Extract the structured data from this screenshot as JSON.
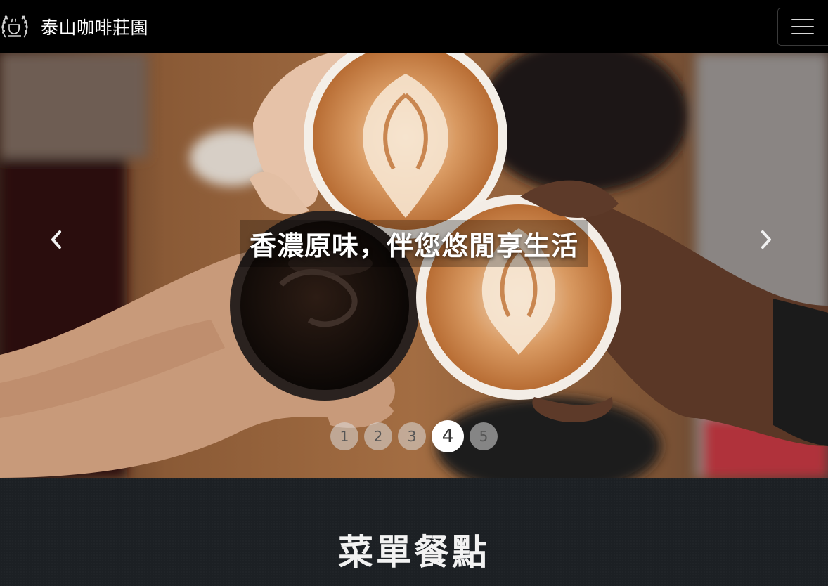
{
  "navbar": {
    "brand_name": "泰山咖啡莊園",
    "logo_icon": "laurel-coffee-crest-icon",
    "menu_icon": "hamburger-menu-icon"
  },
  "carousel": {
    "caption": "香濃原味，伴您悠閒享生活",
    "prev_icon": "chevron-left-icon",
    "next_icon": "chevron-right-icon",
    "indicators": [
      "1",
      "2",
      "3",
      "4",
      "5"
    ],
    "active_index": 4
  },
  "menu_section": {
    "title": "菜單餐點"
  },
  "colors": {
    "navbar_bg": "#000000",
    "section_bg": "#1c2024",
    "text": "#ffffff"
  }
}
